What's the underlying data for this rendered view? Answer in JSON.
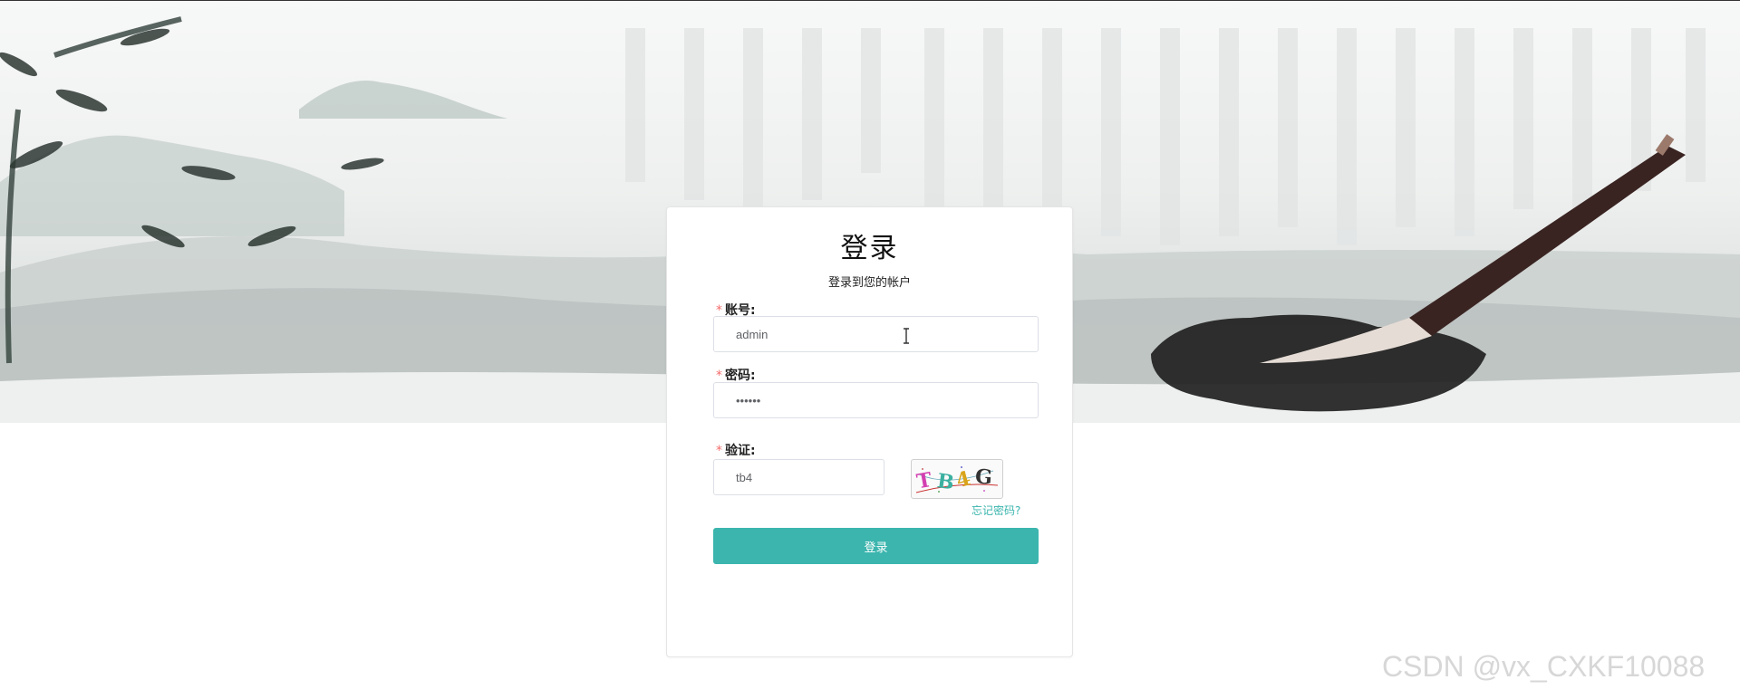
{
  "login": {
    "title": "登录",
    "subtitle": "登录到您的帐户",
    "required_mark": "*",
    "account_label": "账号:",
    "account_value": "admin",
    "password_label": "密码:",
    "password_value": "••••••",
    "verify_label": "验证:",
    "verify_value": "tb4",
    "captcha_text": "TB4G",
    "forgot_link": "忘记密码?",
    "submit_label": "登录"
  },
  "watermark": "CSDN @vx_CXKF10088",
  "colors": {
    "accent": "#3bb5ae",
    "required": "#f56c6c",
    "link": "#3ab5ad"
  }
}
